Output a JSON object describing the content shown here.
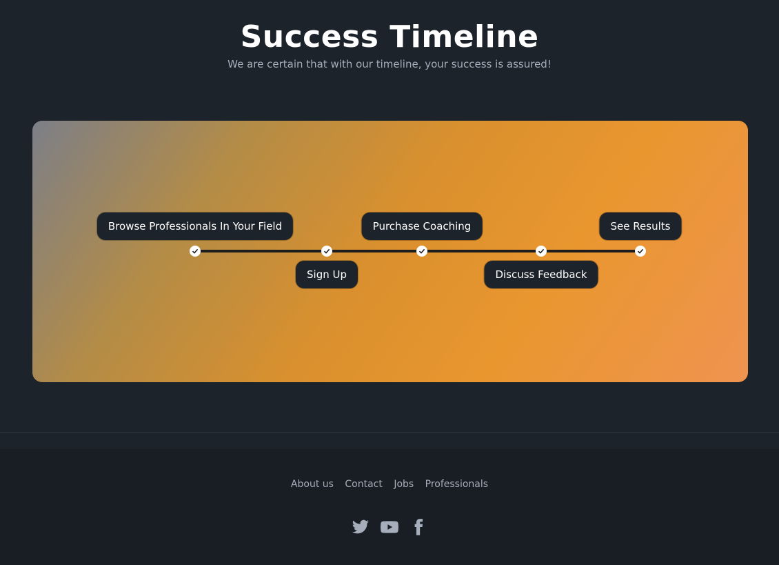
{
  "header": {
    "title": "Success Timeline",
    "subtitle": "We are certain that with our timeline, your success is assured!"
  },
  "timeline": {
    "steps": [
      {
        "label": "Browse Professionals In Your Field",
        "position": "above",
        "completed": true
      },
      {
        "label": "Sign Up",
        "position": "below",
        "completed": true
      },
      {
        "label": "Purchase Coaching",
        "position": "above",
        "completed": true
      },
      {
        "label": "Discuss Feedback",
        "position": "below",
        "completed": true
      },
      {
        "label": "See Results",
        "position": "above",
        "completed": true
      }
    ],
    "node_icon": "check-icon"
  },
  "footer": {
    "links": [
      "About us",
      "Contact",
      "Jobs",
      "Professionals"
    ],
    "socials": [
      "twitter-icon",
      "youtube-icon",
      "facebook-icon"
    ]
  },
  "colors": {
    "background": "#1d232a",
    "footer_background": "#191e24",
    "pill_background": "#1d232a",
    "muted_text": "#a6adbb",
    "accent_gradient_start": "#7c7f88",
    "accent_gradient_end": "#ef9450"
  }
}
